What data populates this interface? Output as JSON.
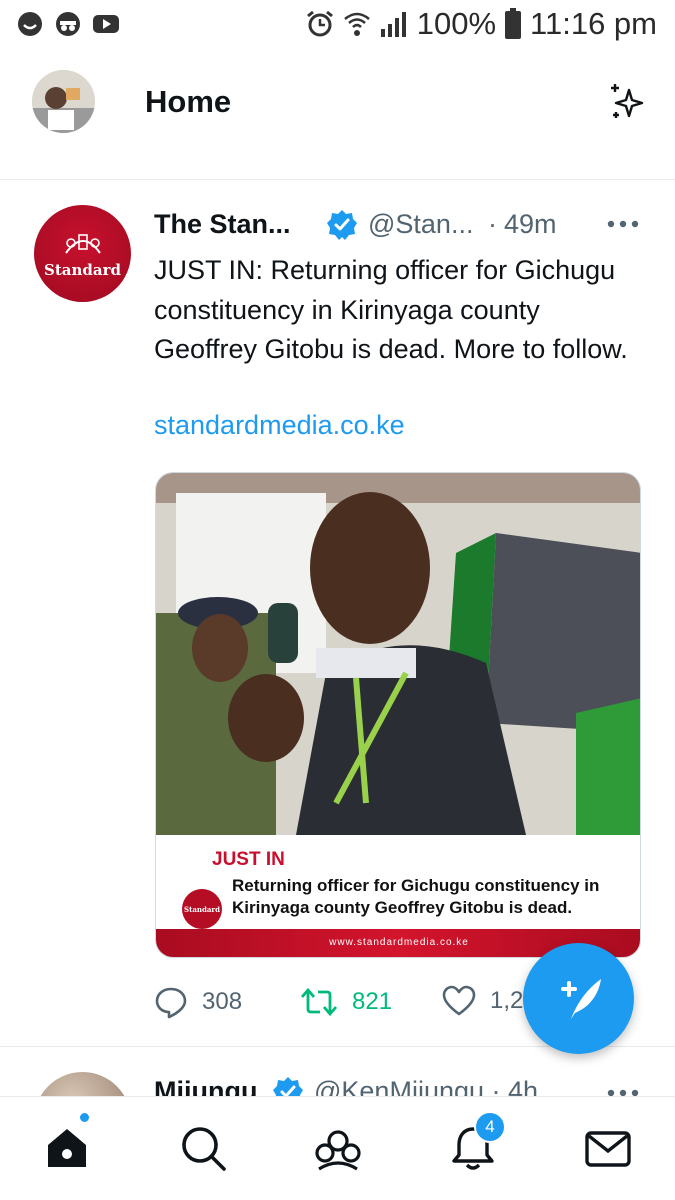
{
  "status_bar": {
    "battery": "100%",
    "time": "11:16 pm",
    "left_icons": [
      "chat-bubble-icon",
      "incognito-icon",
      "youtube-icon"
    ],
    "right_icons": [
      "alarm-icon",
      "wifi-calling-icon",
      "signal-icon",
      "battery-icon"
    ]
  },
  "header": {
    "title": "Home",
    "avatar_icon": "profile-avatar",
    "action_icon": "sparkle-icon"
  },
  "tweet": {
    "author_name": "The Stan...",
    "handle": "@Stan...",
    "separator": "·",
    "time": "49m",
    "avatar_text": "Standard",
    "text": "JUST IN: Returning officer for Gichugu constituency in Kirinyaga county Geoffrey Gitobu is dead. More to follow.",
    "link": "standardmedia.co.ke",
    "media": {
      "headline": "JUST IN",
      "caption": "Returning officer for Gichugu constituency in Kirinyaga county Geoffrey Gitobu is dead.",
      "logo_text": "Standard",
      "footer_url": "www.standardmedia.co.ke"
    },
    "stats": {
      "replies": "308",
      "retweets": "821",
      "likes": "1,2"
    }
  },
  "next_tweet": {
    "author_name": "Mijungu",
    "handle": "@KenMijungu · 4h"
  },
  "fab": {
    "icon": "compose-tweet-icon"
  },
  "bottom_nav": {
    "items": [
      "home-icon",
      "search-icon",
      "communities-icon",
      "notifications-icon",
      "messages-icon"
    ],
    "notification_count": "4"
  },
  "colors": {
    "accent": "#1d9bf0",
    "retweet": "#00ba7c",
    "brand_red": "#c8102e",
    "muted_text": "#536471"
  }
}
